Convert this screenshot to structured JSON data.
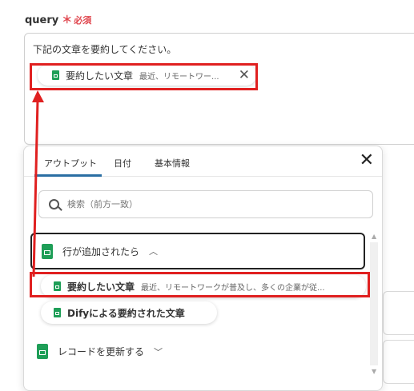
{
  "field": {
    "label": "query",
    "required_star": "＊",
    "required_text": "必須",
    "text": "下記の文章を要約してください。"
  },
  "inserted_chip": {
    "icon": "google-sheets-icon",
    "title": "要約したい文章",
    "preview": "最近、リモートワー...",
    "close": "✕"
  },
  "popup": {
    "tabs": [
      "アウトプット",
      "日付",
      "基本情報"
    ],
    "active_tab": "アウトプット",
    "close": "✕",
    "search_placeholder": "検索（前方一致）",
    "sections": [
      {
        "title": "行が追加されたら",
        "expanded": true,
        "chevron": "︿",
        "items": [
          {
            "title": "要約したい文章",
            "preview": "最近、リモートワークが普及し、多くの企業が従..."
          },
          {
            "title": "Difyによる要約された文章",
            "preview": ""
          }
        ]
      },
      {
        "title": "レコードを更新する",
        "expanded": false,
        "chevron": "﹀"
      }
    ],
    "scroll_up": "▲",
    "scroll_down": "▼"
  },
  "annotation_color": "#e02020",
  "sheets_color": "#1e9e57",
  "accent_color": "#2a6ea3"
}
